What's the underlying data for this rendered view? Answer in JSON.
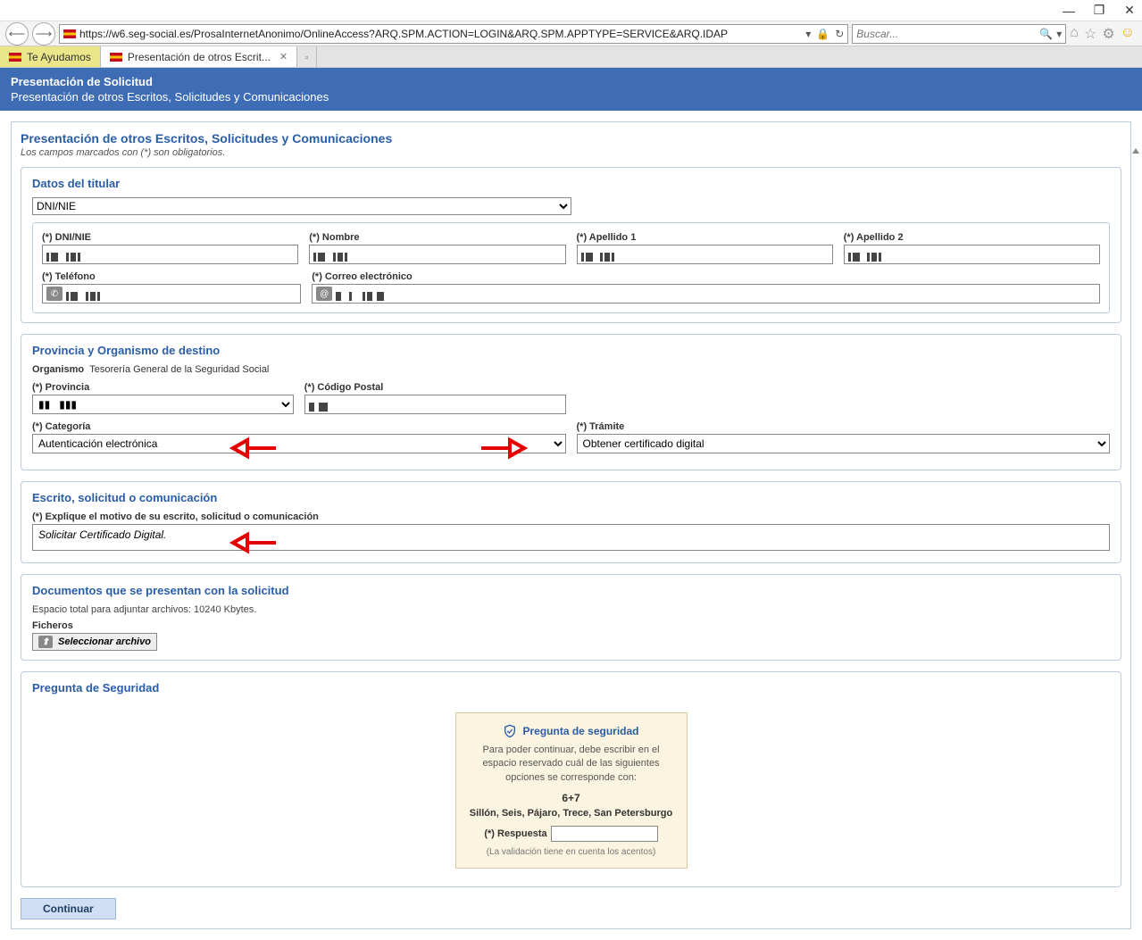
{
  "browser": {
    "url": "https://w6.seg-social.es/ProsaInternetAnonimo/OnlineAccess?ARQ.SPM.ACTION=LOGIN&ARQ.SPM.APPTYPE=SERVICE&ARQ.IDAP",
    "search_placeholder": "Buscar...",
    "tab1": "Te Ayudamos",
    "tab2": "Presentación de otros Escrit..."
  },
  "header": {
    "title": "Presentación de Solicitud",
    "subtitle": "Presentación de otros Escritos, Solicitudes y Comunicaciones"
  },
  "form": {
    "title": "Presentación de otros Escritos, Solicitudes y Comunicaciones",
    "hint": "Los campos marcados con (*) son obligatorios."
  },
  "datos": {
    "title": "Datos del titular",
    "id_type": "DNI/NIE",
    "dni_label": "(*) DNI/NIE",
    "nombre_label": "(*) Nombre",
    "apellido1_label": "(*) Apellido 1",
    "apellido2_label": "(*) Apellido 2",
    "telefono_label": "(*) Teléfono",
    "correo_label": "(*) Correo electrónico"
  },
  "provincia": {
    "title": "Provincia y Organismo de destino",
    "org_label": "Organismo",
    "org_value": "Tesorería General de la Seguridad Social",
    "provincia_label": "(*) Provincia",
    "cp_label": "(*) Código Postal",
    "categoria_label": "(*) Categoría",
    "categoria_value": "Autenticación electrónica",
    "tramite_label": "(*) Trámite",
    "tramite_value": "Obtener certificado digital"
  },
  "escrito": {
    "title": "Escrito, solicitud o comunicación",
    "motivo_label": "(*) Explique el motivo de su escrito, solicitud o comunicación",
    "motivo_value": "Solicitar Certificado Digital."
  },
  "docs": {
    "title": "Documentos que se presentan con la solicitud",
    "hint": "Espacio total para adjuntar archivos: 10240 Kbytes.",
    "ficheros_label": "Ficheros",
    "select_file": "Seleccionar archivo"
  },
  "security": {
    "title": "Pregunta de Seguridad",
    "box_title": "Pregunta de seguridad",
    "text": "Para poder continuar, debe escribir en el espacio reservado cuál de las siguientes opciones se corresponde con:",
    "question": "6+7",
    "options": "Sillón, Seis, Pájaro, Trece, San Petersburgo",
    "respuesta_label": "(*) Respuesta",
    "note": "(La validación tiene en cuenta los acentos)"
  },
  "actions": {
    "continue": "Continuar"
  }
}
